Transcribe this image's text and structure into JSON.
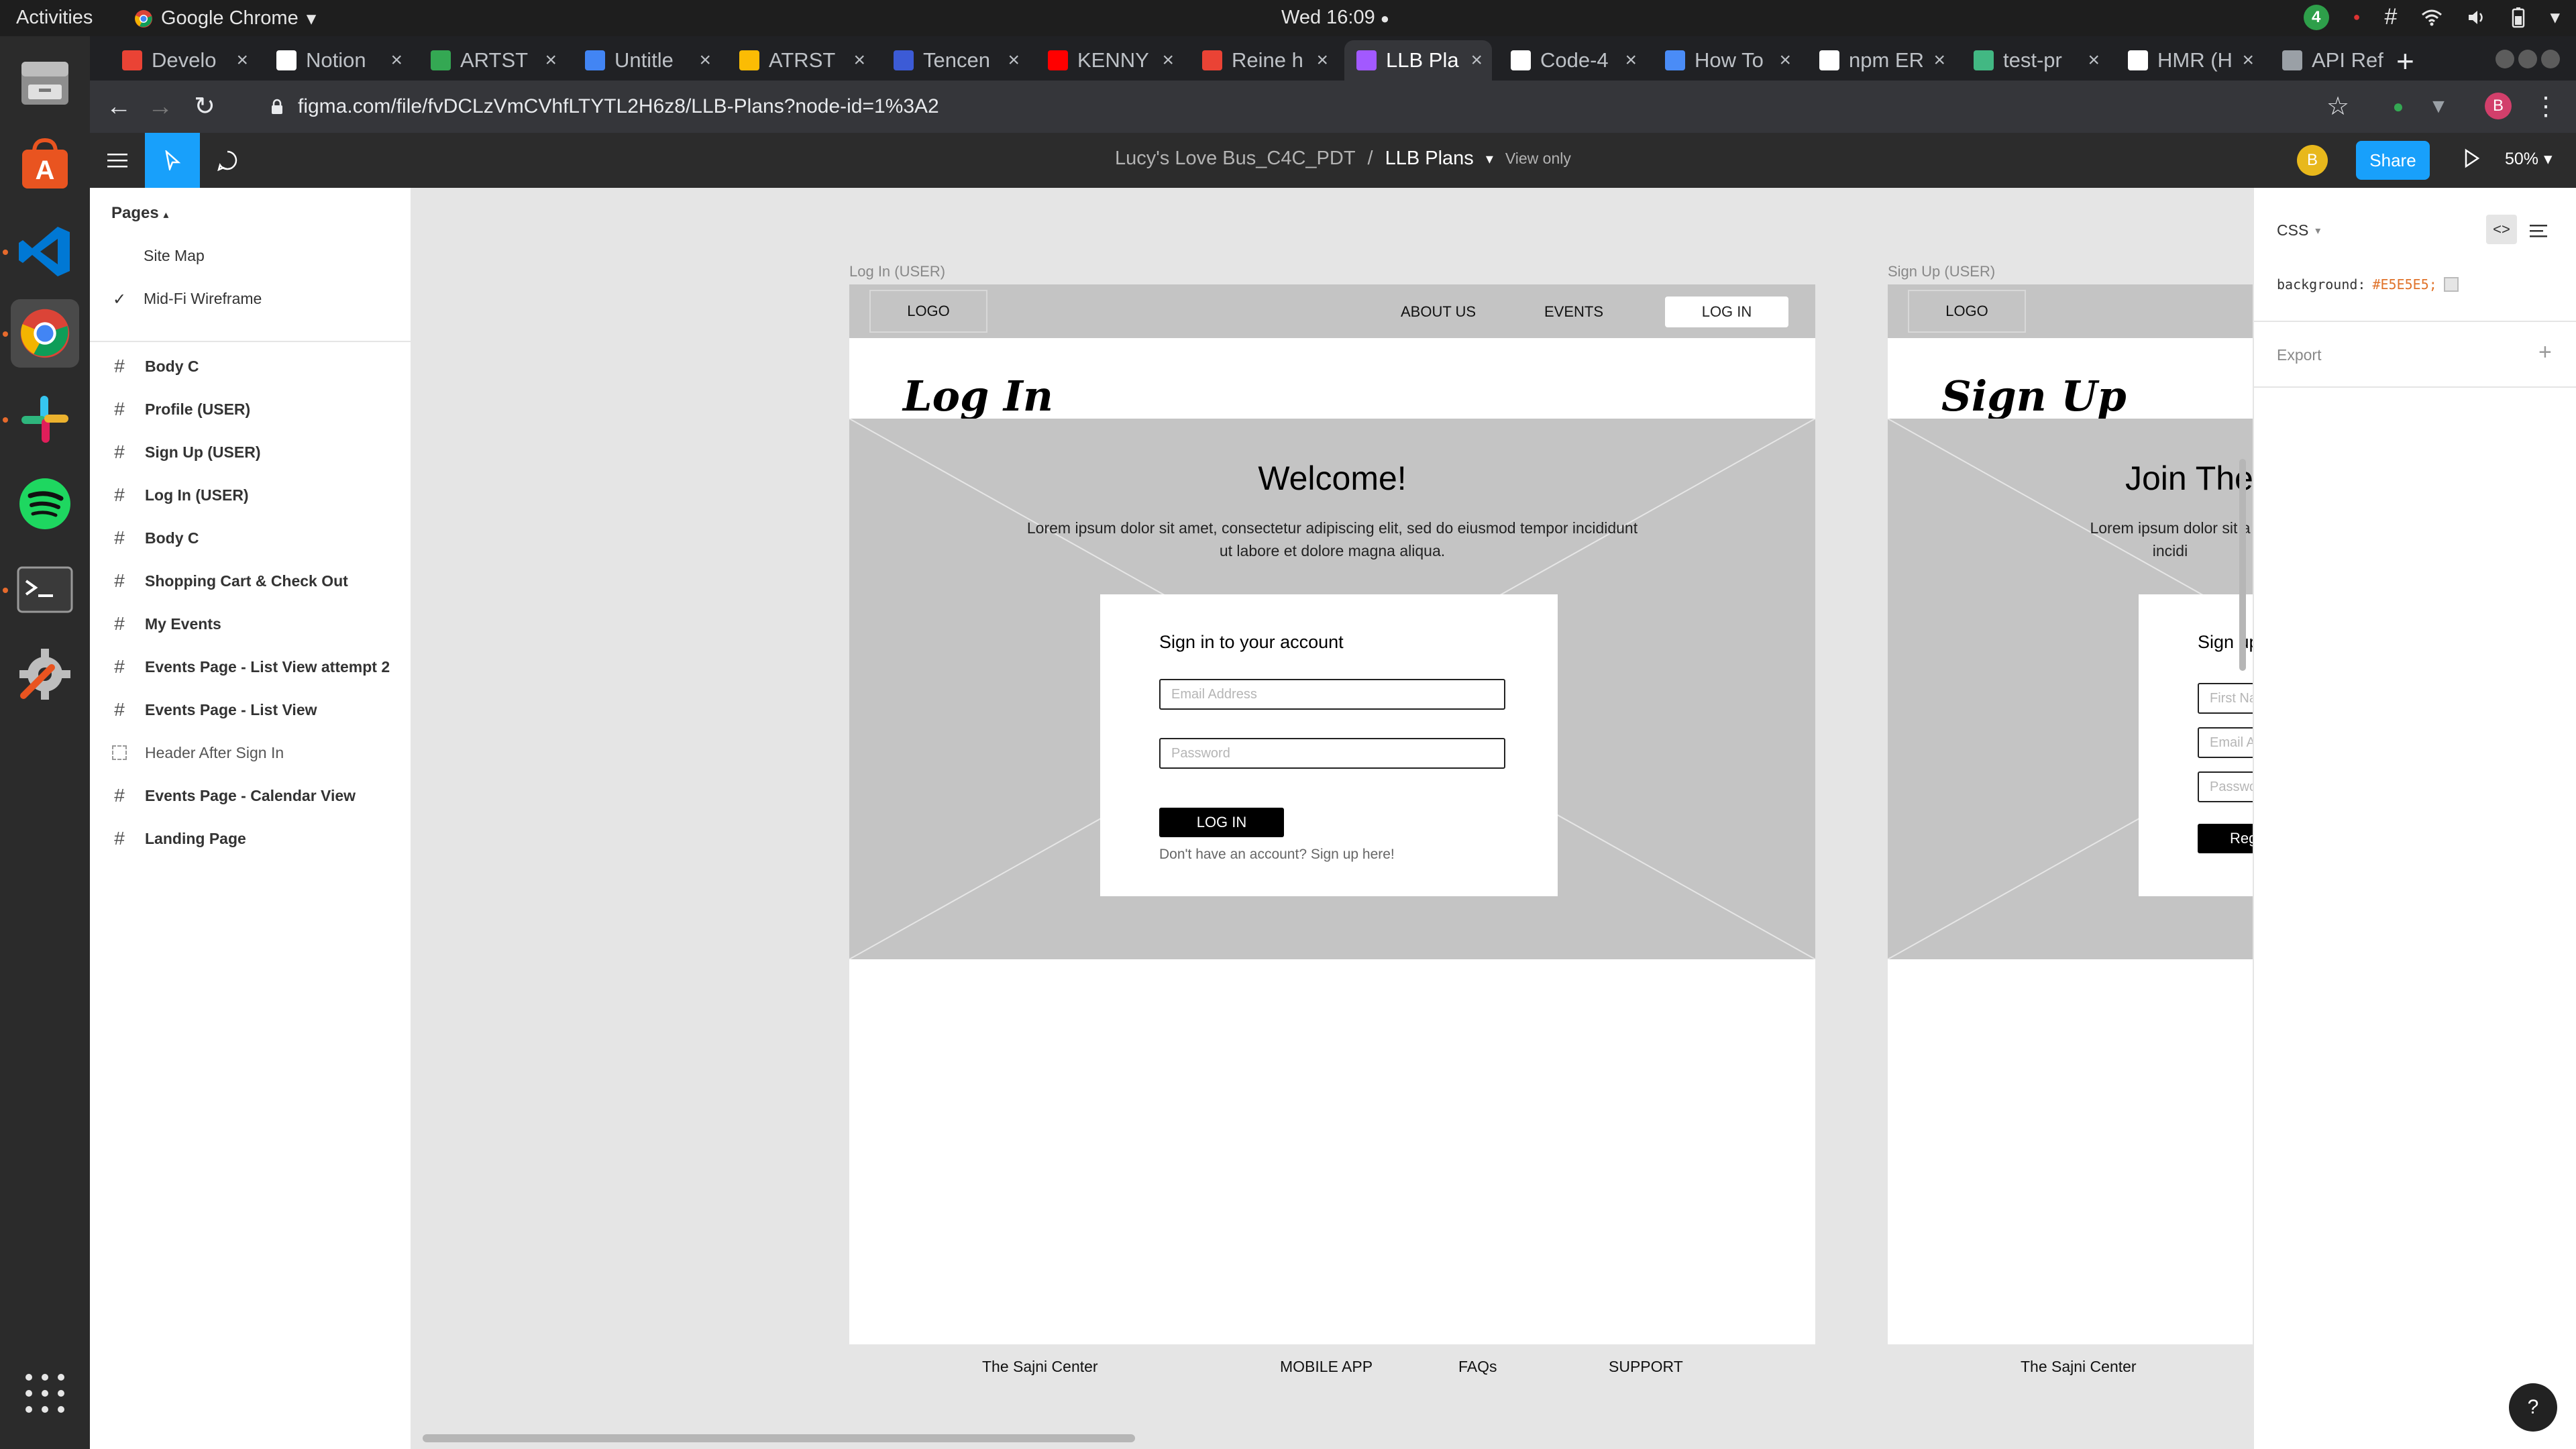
{
  "os": {
    "activities": "Activities",
    "app_name": "Google Chrome",
    "clock": "Wed 16:09",
    "notif_count": "4"
  },
  "browser": {
    "tabs": [
      {
        "label": "Develo",
        "color": "#ea4335"
      },
      {
        "label": "Notion",
        "color": "#ffffff"
      },
      {
        "label": "ARTST",
        "color": "#34a853"
      },
      {
        "label": "Untitle",
        "color": "#4285f4"
      },
      {
        "label": "ATRST",
        "color": "#fbbc04"
      },
      {
        "label": "Tencen",
        "color": "#3c5bd6"
      },
      {
        "label": "KENNY",
        "color": "#ff0000"
      },
      {
        "label": "Reine h",
        "color": "#ea4335"
      },
      {
        "label": "LLB Pla",
        "color": "#a259ff"
      },
      {
        "label": "Code-4",
        "color": "#ffffff"
      },
      {
        "label": "How To",
        "color": "#4a8cf7"
      },
      {
        "label": "npm ER",
        "color": "#ffffff"
      },
      {
        "label": "test-pr",
        "color": "#42b883"
      },
      {
        "label": "HMR (H",
        "color": "#ffffff"
      },
      {
        "label": "API Ref",
        "color": "#9aa0a6"
      }
    ],
    "url": "figma.com/file/fvDCLzVmCVhfLTYTL2H6z8/LLB-Plans?node-id=1%3A2",
    "profile_initial": "B"
  },
  "figma": {
    "file_name": "Lucy's Love Bus_C4C_PDT",
    "separator": "/",
    "current_page": "LLB Plans",
    "mode": "View only",
    "avatar_initial": "B",
    "share_label": "Share",
    "zoom": "50%"
  },
  "pages_panel": {
    "header": "Pages",
    "pages": [
      {
        "label": "Site Map",
        "checked": false
      },
      {
        "label": "Mid-Fi Wireframe",
        "checked": true
      }
    ],
    "layers": [
      {
        "label": "Body C",
        "kind": "frame"
      },
      {
        "label": "Profile (USER)",
        "kind": "frame"
      },
      {
        "label": "Sign Up (USER)",
        "kind": "frame"
      },
      {
        "label": "Log In (USER)",
        "kind": "frame"
      },
      {
        "label": "Body C",
        "kind": "frame"
      },
      {
        "label": "Shopping Cart & Check Out",
        "kind": "frame"
      },
      {
        "label": "My Events",
        "kind": "frame"
      },
      {
        "label": "Events Page - List View attempt 2",
        "kind": "frame"
      },
      {
        "label": "Events Page - List View",
        "kind": "frame"
      },
      {
        "label": "Header After Sign In",
        "kind": "component"
      },
      {
        "label": "Events Page - Calendar View",
        "kind": "frame"
      },
      {
        "label": "Landing Page",
        "kind": "frame"
      }
    ]
  },
  "login_frame": {
    "frame_label": "Log In (USER)",
    "logo": "LOGO",
    "nav": [
      "ABOUT US",
      "EVENTS"
    ],
    "nav_button": "LOG IN",
    "title": "Log In",
    "welcome": "Welcome!",
    "lorem": "Lorem ipsum dolor sit amet, consectetur adipiscing elit, sed do eiusmod tempor incididunt ut labore et dolore magna aliqua.",
    "card_title": "Sign in to your account",
    "email_placeholder": "Email Address",
    "password_placeholder": "Password",
    "submit": "LOG IN",
    "signup_prompt": "Don't have an account? Sign up here!",
    "footer": [
      "The Sajni Center",
      "MOBILE APP",
      "FAQs",
      "SUPPORT"
    ]
  },
  "signup_frame": {
    "frame_label": "Sign Up (USER)",
    "logo": "LOGO",
    "title": "Sign Up",
    "welcome": "Join The",
    "lorem": "Lorem ipsum dolor sit a incidi",
    "card_title": "Sign up",
    "first_name_placeholder": "First Na",
    "email_placeholder": "Email A",
    "password_placeholder": "Passwo",
    "submit": "Reg",
    "footer": "The Sajni Center"
  },
  "inspect": {
    "tab": "CSS",
    "property": "background:",
    "value": "#E5E5E5;",
    "export_label": "Export"
  },
  "help": "?"
}
